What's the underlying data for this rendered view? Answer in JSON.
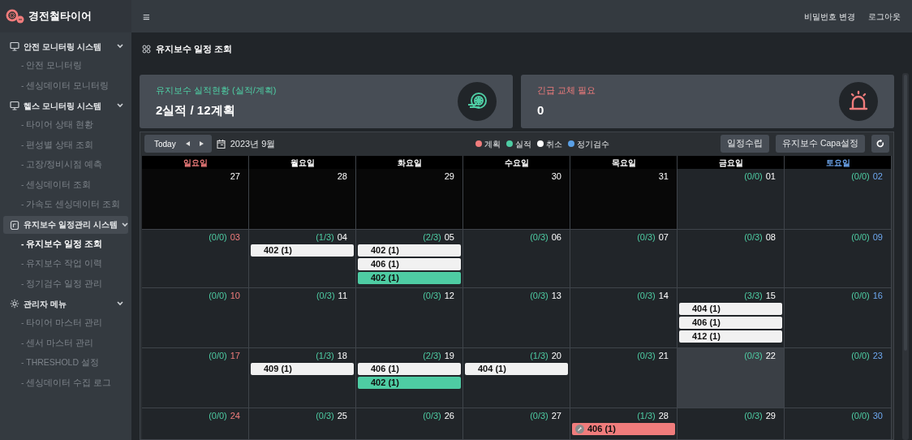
{
  "app": {
    "title": "경전철타이어"
  },
  "topbar": {
    "menu_glyph": "≡",
    "links": [
      "비밀번호 변경",
      "로그아웃"
    ]
  },
  "sidebar": {
    "sections": [
      {
        "label": "안전 모니터링 시스템",
        "kind": "monitor",
        "expanded": true,
        "selected": false,
        "children": [
          {
            "label": "- 안전 모니터링",
            "selected": false
          },
          {
            "label": "- 센싱데이터 모니터링",
            "selected": false
          }
        ]
      },
      {
        "label": "헬스 모니터링 시스템",
        "kind": "monitor",
        "expanded": true,
        "selected": false,
        "children": [
          {
            "label": "- 타이어 상태 현황",
            "selected": false
          },
          {
            "label": "- 편성별 상태 조회",
            "selected": false
          },
          {
            "label": "- 고장/정비시점 예측",
            "selected": false
          },
          {
            "label": "- 센싱데이터 조회",
            "selected": false
          },
          {
            "label": "- 가속도 센싱데이터 조회",
            "selected": false
          }
        ]
      },
      {
        "label": "유지보수 일정관리 시스템",
        "kind": "clipboard",
        "expanded": true,
        "selected": true,
        "children": [
          {
            "label": "- 유지보수 일정 조회",
            "selected": true
          },
          {
            "label": "- 유지보수 작업 이력",
            "selected": false
          },
          {
            "label": "- 정기검수 일정 관리",
            "selected": false
          }
        ]
      },
      {
        "label": "관리자 메뉴",
        "kind": "gear",
        "expanded": true,
        "selected": false,
        "children": [
          {
            "label": "- 타이어 마스터 관리",
            "selected": false
          },
          {
            "label": "- 센서 마스터 관리",
            "selected": false
          },
          {
            "label": "- THRESHOLD 설정",
            "selected": false
          },
          {
            "label": "- 센싱데이터 수집 로그",
            "selected": false
          }
        ]
      }
    ]
  },
  "page": {
    "title": "유지보수 일정 조회"
  },
  "cards": [
    {
      "title": "유지보수 실적현황 (실적/계획)",
      "value": "2실적 / 12계획",
      "kind": "tire",
      "color": "#4ecca3"
    },
    {
      "title": "긴급 교체 필요",
      "value": "0",
      "kind": "alarm",
      "color": "#f07c7c"
    }
  ],
  "calendar": {
    "today_button": "Today",
    "month": "2023년 9월",
    "legend": [
      {
        "label": "계획",
        "color": "#f07c7c"
      },
      {
        "label": "실적",
        "color": "#4ecca3"
      },
      {
        "label": "취소",
        "color": "#ffffff"
      },
      {
        "label": "정기검수",
        "color": "#5aa0e6"
      }
    ],
    "buttons": [
      "일정수립",
      "유지보수 Capa설정"
    ],
    "weekdays": [
      {
        "label": "일요일",
        "kind": "sun"
      },
      {
        "label": "월요일",
        "kind": "weekday"
      },
      {
        "label": "화요일",
        "kind": "weekday"
      },
      {
        "label": "수요일",
        "kind": "weekday"
      },
      {
        "label": "목요일",
        "kind": "weekday"
      },
      {
        "label": "금요일",
        "kind": "weekday"
      },
      {
        "label": "토요일",
        "kind": "sat"
      }
    ],
    "weeks": [
      [
        {
          "day": "27",
          "kind": "other",
          "today": false
        },
        {
          "day": "28",
          "kind": "other",
          "today": false
        },
        {
          "day": "29",
          "kind": "other",
          "today": false
        },
        {
          "day": "30",
          "kind": "other",
          "today": false
        },
        {
          "day": "31",
          "kind": "other",
          "today": false
        },
        {
          "count": "(0/0)",
          "day": "01",
          "kind": "weekday",
          "today": false
        },
        {
          "count": "(0/0)",
          "day": "02",
          "kind": "sat",
          "today": false
        }
      ],
      [
        {
          "count": "(0/0)",
          "day": "03",
          "kind": "sun",
          "today": false
        },
        {
          "count": "(1/3)",
          "day": "04",
          "kind": "weekday",
          "today": false,
          "events": [
            {
              "label": "402 (1)",
              "kind": "plan"
            }
          ]
        },
        {
          "count": "(2/3)",
          "day": "05",
          "kind": "weekday",
          "today": false,
          "events": [
            {
              "label": "402 (1)",
              "kind": "plan"
            },
            {
              "label": "406 (1)",
              "kind": "plan"
            },
            {
              "label": "402 (1)",
              "kind": "done"
            }
          ]
        },
        {
          "count": "(0/3)",
          "day": "06",
          "kind": "weekday",
          "today": false
        },
        {
          "count": "(0/3)",
          "day": "07",
          "kind": "weekday",
          "today": false
        },
        {
          "count": "(0/3)",
          "day": "08",
          "kind": "weekday",
          "today": false
        },
        {
          "count": "(0/0)",
          "day": "09",
          "kind": "sat",
          "today": false
        }
      ],
      [
        {
          "count": "(0/0)",
          "day": "10",
          "kind": "sun",
          "today": false
        },
        {
          "count": "(0/3)",
          "day": "11",
          "kind": "weekday",
          "today": false
        },
        {
          "count": "(0/3)",
          "day": "12",
          "kind": "weekday",
          "today": false
        },
        {
          "count": "(0/3)",
          "day": "13",
          "kind": "weekday",
          "today": false
        },
        {
          "count": "(0/3)",
          "day": "14",
          "kind": "weekday",
          "today": false
        },
        {
          "count": "(3/3)",
          "day": "15",
          "kind": "weekday",
          "today": false,
          "events": [
            {
              "label": "404 (1)",
              "kind": "plan"
            },
            {
              "label": "406 (1)",
              "kind": "plan"
            },
            {
              "label": "412 (1)",
              "kind": "plan"
            }
          ]
        },
        {
          "count": "(0/0)",
          "day": "16",
          "kind": "sat",
          "today": false
        }
      ],
      [
        {
          "count": "(0/0)",
          "day": "17",
          "kind": "sun",
          "today": false
        },
        {
          "count": "(1/3)",
          "day": "18",
          "kind": "weekday",
          "today": false,
          "events": [
            {
              "label": "409 (1)",
              "kind": "plan"
            }
          ]
        },
        {
          "count": "(2/3)",
          "day": "19",
          "kind": "weekday",
          "today": false,
          "events": [
            {
              "label": "406 (1)",
              "kind": "plan"
            },
            {
              "label": "402 (1)",
              "kind": "done"
            }
          ]
        },
        {
          "count": "(1/3)",
          "day": "20",
          "kind": "weekday",
          "today": false,
          "events": [
            {
              "label": "404 (1)",
              "kind": "plan"
            }
          ]
        },
        {
          "count": "(0/3)",
          "day": "21",
          "kind": "weekday",
          "today": false
        },
        {
          "count": "(0/3)",
          "day": "22",
          "kind": "weekday",
          "today": true
        },
        {
          "count": "(0/0)",
          "day": "23",
          "kind": "sat",
          "today": false
        }
      ],
      [
        {
          "count": "(0/0)",
          "day": "24",
          "kind": "sun",
          "today": false
        },
        {
          "count": "(0/3)",
          "day": "25",
          "kind": "weekday",
          "today": false
        },
        {
          "count": "(0/3)",
          "day": "26",
          "kind": "weekday",
          "today": false
        },
        {
          "count": "(0/3)",
          "day": "27",
          "kind": "weekday",
          "today": false
        },
        {
          "count": "(1/3)",
          "day": "28",
          "kind": "weekday",
          "today": false,
          "events": [
            {
              "label": "406 (1)",
              "kind": "urgent"
            }
          ]
        },
        {
          "count": "(0/3)",
          "day": "29",
          "kind": "weekday",
          "today": false
        },
        {
          "count": "(0/0)",
          "day": "30",
          "kind": "sat",
          "today": false
        }
      ]
    ]
  }
}
